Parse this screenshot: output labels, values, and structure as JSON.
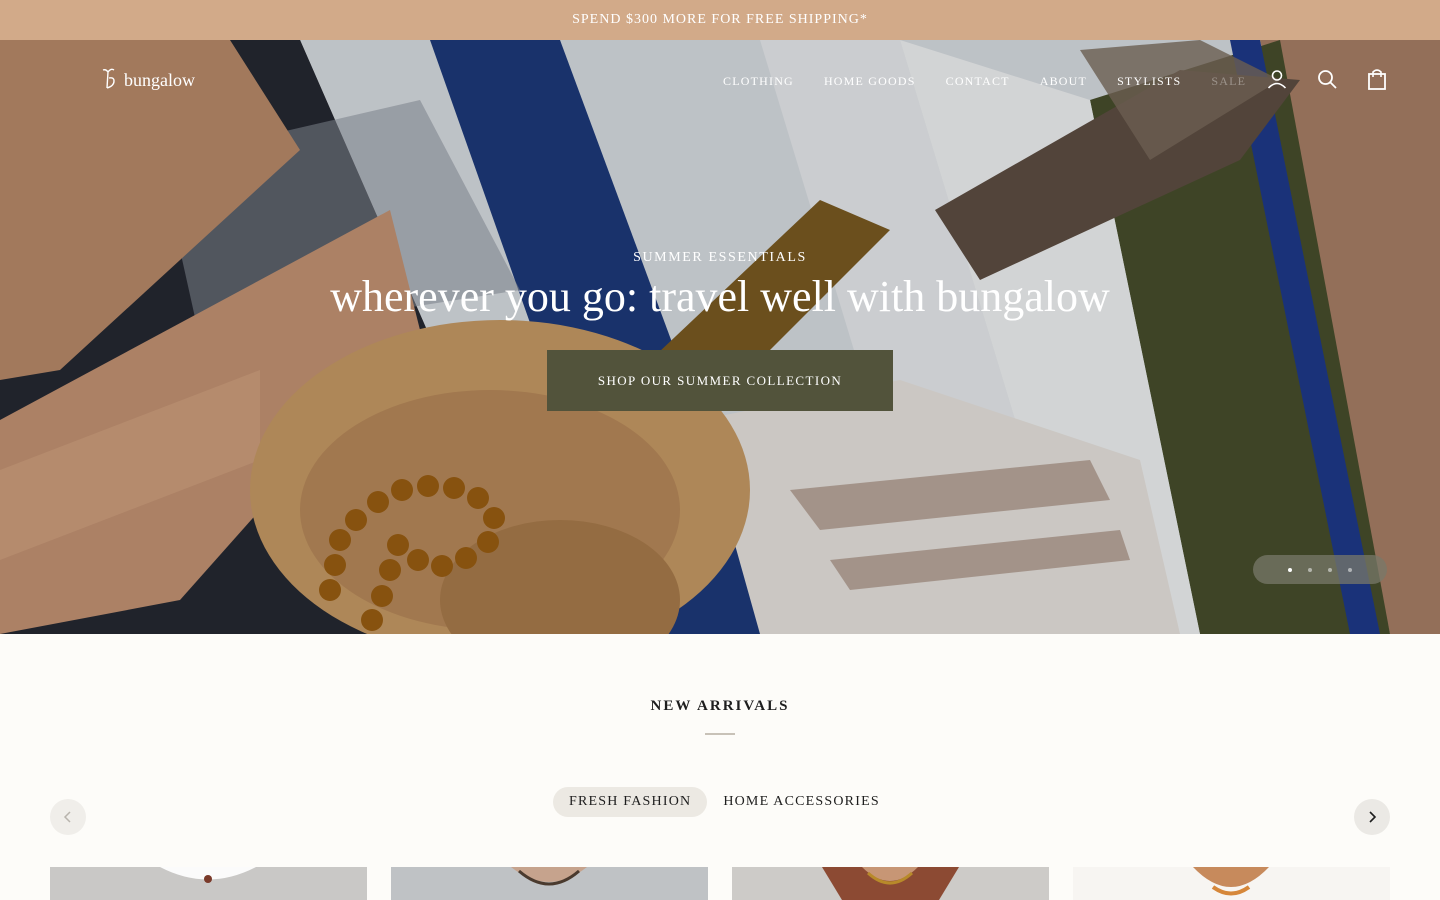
{
  "announcement": {
    "text": "SPEND $300 MORE FOR FREE SHIPPING*"
  },
  "brand": {
    "name": "bungalow"
  },
  "nav": {
    "items": [
      {
        "label": "CLOTHING"
      },
      {
        "label": "HOME GOODS"
      },
      {
        "label": "CONTACT"
      },
      {
        "label": "ABOUT"
      },
      {
        "label": "STYLISTS"
      },
      {
        "label": "SALE"
      }
    ]
  },
  "header_icons": [
    "account-icon",
    "search-icon",
    "cart-icon"
  ],
  "hero": {
    "eyebrow": "SUMMER ESSENTIALS",
    "title": "wherever you go: travel well with bungalow",
    "cta": "SHOP OUR SUMMER COLLECTION",
    "slides_count": 4,
    "active_slide": 1
  },
  "new_arrivals": {
    "title": "NEW ARRIVALS",
    "tabs": [
      {
        "label": "FRESH FASHION",
        "active": true
      },
      {
        "label": "HOME ACCESSORIES",
        "active": false
      }
    ]
  },
  "colors": {
    "announcement_bg": "#d2aa89",
    "cta_bg": "#52533b",
    "page_bg": "#fdfcf9"
  }
}
